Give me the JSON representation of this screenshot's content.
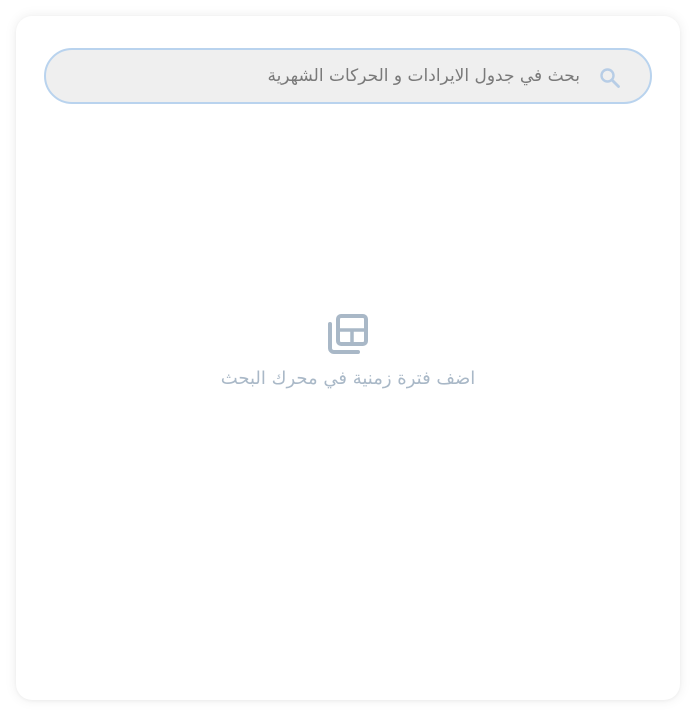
{
  "search": {
    "placeholder": "بحث في جدول الايرادات و الحركات الشهرية",
    "icon": "search-icon",
    "border_color": "#b9d3ee",
    "background_color": "#efefef"
  },
  "empty_state": {
    "icon": "library-books-icon",
    "message": "اضف فترة زمنية في محرك البحث",
    "color": "#a9b8c7"
  }
}
